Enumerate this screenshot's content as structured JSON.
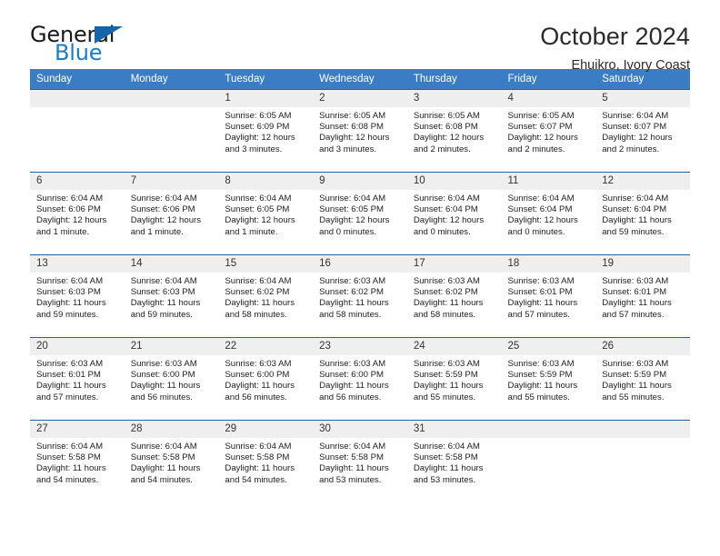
{
  "brand": {
    "word_one": "General",
    "word_two": "Blue",
    "triangle_icon": "brand-triangle-icon"
  },
  "header": {
    "month_title": "October 2024",
    "location": "Ehuikro, Ivory Coast"
  },
  "colors": {
    "header_blue": "#3b7dc4",
    "row_border_blue": "#1f63a8",
    "daynum_band": "#efefef",
    "brand_blue": "#1f7ac4",
    "triangle_blue": "#1765a8"
  },
  "calendar": {
    "weekdays": [
      "Sunday",
      "Monday",
      "Tuesday",
      "Wednesday",
      "Thursday",
      "Friday",
      "Saturday"
    ],
    "weeks": [
      [
        {
          "day": "",
          "sunrise": "",
          "sunset": "",
          "daylight": ""
        },
        {
          "day": "",
          "sunrise": "",
          "sunset": "",
          "daylight": ""
        },
        {
          "day": "1",
          "sunrise": "Sunrise: 6:05 AM",
          "sunset": "Sunset: 6:09 PM",
          "daylight": "Daylight: 12 hours and 3 minutes."
        },
        {
          "day": "2",
          "sunrise": "Sunrise: 6:05 AM",
          "sunset": "Sunset: 6:08 PM",
          "daylight": "Daylight: 12 hours and 3 minutes."
        },
        {
          "day": "3",
          "sunrise": "Sunrise: 6:05 AM",
          "sunset": "Sunset: 6:08 PM",
          "daylight": "Daylight: 12 hours and 2 minutes."
        },
        {
          "day": "4",
          "sunrise": "Sunrise: 6:05 AM",
          "sunset": "Sunset: 6:07 PM",
          "daylight": "Daylight: 12 hours and 2 minutes."
        },
        {
          "day": "5",
          "sunrise": "Sunrise: 6:04 AM",
          "sunset": "Sunset: 6:07 PM",
          "daylight": "Daylight: 12 hours and 2 minutes."
        }
      ],
      [
        {
          "day": "6",
          "sunrise": "Sunrise: 6:04 AM",
          "sunset": "Sunset: 6:06 PM",
          "daylight": "Daylight: 12 hours and 1 minute."
        },
        {
          "day": "7",
          "sunrise": "Sunrise: 6:04 AM",
          "sunset": "Sunset: 6:06 PM",
          "daylight": "Daylight: 12 hours and 1 minute."
        },
        {
          "day": "8",
          "sunrise": "Sunrise: 6:04 AM",
          "sunset": "Sunset: 6:05 PM",
          "daylight": "Daylight: 12 hours and 1 minute."
        },
        {
          "day": "9",
          "sunrise": "Sunrise: 6:04 AM",
          "sunset": "Sunset: 6:05 PM",
          "daylight": "Daylight: 12 hours and 0 minutes."
        },
        {
          "day": "10",
          "sunrise": "Sunrise: 6:04 AM",
          "sunset": "Sunset: 6:04 PM",
          "daylight": "Daylight: 12 hours and 0 minutes."
        },
        {
          "day": "11",
          "sunrise": "Sunrise: 6:04 AM",
          "sunset": "Sunset: 6:04 PM",
          "daylight": "Daylight: 12 hours and 0 minutes."
        },
        {
          "day": "12",
          "sunrise": "Sunrise: 6:04 AM",
          "sunset": "Sunset: 6:04 PM",
          "daylight": "Daylight: 11 hours and 59 minutes."
        }
      ],
      [
        {
          "day": "13",
          "sunrise": "Sunrise: 6:04 AM",
          "sunset": "Sunset: 6:03 PM",
          "daylight": "Daylight: 11 hours and 59 minutes."
        },
        {
          "day": "14",
          "sunrise": "Sunrise: 6:04 AM",
          "sunset": "Sunset: 6:03 PM",
          "daylight": "Daylight: 11 hours and 59 minutes."
        },
        {
          "day": "15",
          "sunrise": "Sunrise: 6:04 AM",
          "sunset": "Sunset: 6:02 PM",
          "daylight": "Daylight: 11 hours and 58 minutes."
        },
        {
          "day": "16",
          "sunrise": "Sunrise: 6:03 AM",
          "sunset": "Sunset: 6:02 PM",
          "daylight": "Daylight: 11 hours and 58 minutes."
        },
        {
          "day": "17",
          "sunrise": "Sunrise: 6:03 AM",
          "sunset": "Sunset: 6:02 PM",
          "daylight": "Daylight: 11 hours and 58 minutes."
        },
        {
          "day": "18",
          "sunrise": "Sunrise: 6:03 AM",
          "sunset": "Sunset: 6:01 PM",
          "daylight": "Daylight: 11 hours and 57 minutes."
        },
        {
          "day": "19",
          "sunrise": "Sunrise: 6:03 AM",
          "sunset": "Sunset: 6:01 PM",
          "daylight": "Daylight: 11 hours and 57 minutes."
        }
      ],
      [
        {
          "day": "20",
          "sunrise": "Sunrise: 6:03 AM",
          "sunset": "Sunset: 6:01 PM",
          "daylight": "Daylight: 11 hours and 57 minutes."
        },
        {
          "day": "21",
          "sunrise": "Sunrise: 6:03 AM",
          "sunset": "Sunset: 6:00 PM",
          "daylight": "Daylight: 11 hours and 56 minutes."
        },
        {
          "day": "22",
          "sunrise": "Sunrise: 6:03 AM",
          "sunset": "Sunset: 6:00 PM",
          "daylight": "Daylight: 11 hours and 56 minutes."
        },
        {
          "day": "23",
          "sunrise": "Sunrise: 6:03 AM",
          "sunset": "Sunset: 6:00 PM",
          "daylight": "Daylight: 11 hours and 56 minutes."
        },
        {
          "day": "24",
          "sunrise": "Sunrise: 6:03 AM",
          "sunset": "Sunset: 5:59 PM",
          "daylight": "Daylight: 11 hours and 55 minutes."
        },
        {
          "day": "25",
          "sunrise": "Sunrise: 6:03 AM",
          "sunset": "Sunset: 5:59 PM",
          "daylight": "Daylight: 11 hours and 55 minutes."
        },
        {
          "day": "26",
          "sunrise": "Sunrise: 6:03 AM",
          "sunset": "Sunset: 5:59 PM",
          "daylight": "Daylight: 11 hours and 55 minutes."
        }
      ],
      [
        {
          "day": "27",
          "sunrise": "Sunrise: 6:04 AM",
          "sunset": "Sunset: 5:58 PM",
          "daylight": "Daylight: 11 hours and 54 minutes."
        },
        {
          "day": "28",
          "sunrise": "Sunrise: 6:04 AM",
          "sunset": "Sunset: 5:58 PM",
          "daylight": "Daylight: 11 hours and 54 minutes."
        },
        {
          "day": "29",
          "sunrise": "Sunrise: 6:04 AM",
          "sunset": "Sunset: 5:58 PM",
          "daylight": "Daylight: 11 hours and 54 minutes."
        },
        {
          "day": "30",
          "sunrise": "Sunrise: 6:04 AM",
          "sunset": "Sunset: 5:58 PM",
          "daylight": "Daylight: 11 hours and 53 minutes."
        },
        {
          "day": "31",
          "sunrise": "Sunrise: 6:04 AM",
          "sunset": "Sunset: 5:58 PM",
          "daylight": "Daylight: 11 hours and 53 minutes."
        },
        {
          "day": "",
          "sunrise": "",
          "sunset": "",
          "daylight": ""
        },
        {
          "day": "",
          "sunrise": "",
          "sunset": "",
          "daylight": ""
        }
      ]
    ]
  }
}
